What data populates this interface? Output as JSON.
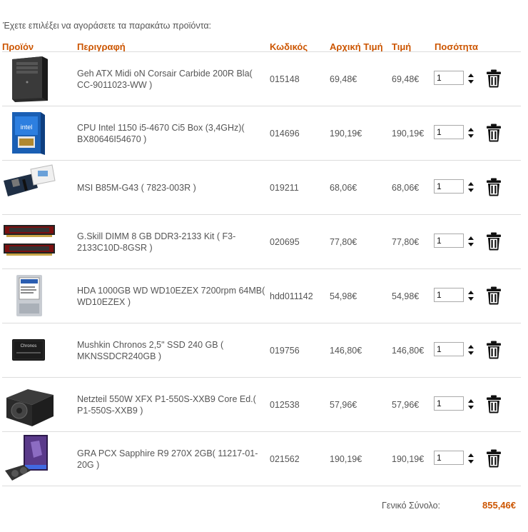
{
  "intro": "Έχετε επιλέξει να αγοράσετε τα παρακάτω προϊόντα:",
  "headers": {
    "product": "Προϊόν",
    "description": "Περιγραφή",
    "code": "Κωδικός",
    "original_price": "Αρχική Τιμή",
    "price": "Τιμή",
    "quantity": "Ποσότητα"
  },
  "items": [
    {
      "image_icon": "pc-case-icon",
      "description": "Geh ATX Midi oN Corsair Carbide 200R Bla( CC-9011023-WW )",
      "code": "015148",
      "original_price": "69,48€",
      "price": "69,48€",
      "quantity": "1"
    },
    {
      "image_icon": "cpu-box-icon",
      "description": "CPU Intel 1150 i5-4670 Ci5 Box (3,4GHz)( BX80646I54670 )",
      "code": "014696",
      "original_price": "190,19€",
      "price": "190,19€",
      "quantity": "1"
    },
    {
      "image_icon": "motherboard-icon",
      "description": "MSI B85M-G43 ( 7823-003R )",
      "code": "019211",
      "original_price": "68,06€",
      "price": "68,06€",
      "quantity": "1"
    },
    {
      "image_icon": "ram-module-icon",
      "description": "G.Skill DIMM 8 GB DDR3-2133 Kit ( F3-2133C10D-8GSR )",
      "code": "020695",
      "original_price": "77,80€",
      "price": "77,80€",
      "quantity": "1"
    },
    {
      "image_icon": "hard-drive-icon",
      "description": "HDA 1000GB WD WD10EZEX 7200rpm 64MB( WD10EZEX )",
      "code": "hdd011142",
      "original_price": "54,98€",
      "price": "54,98€",
      "quantity": "1"
    },
    {
      "image_icon": "ssd-icon",
      "description": "Mushkin Chronos 2,5\" SSD 240 GB ( MKNSSDCR240GB )",
      "code": "019756",
      "original_price": "146,80€",
      "price": "146,80€",
      "quantity": "1"
    },
    {
      "image_icon": "power-supply-icon",
      "description": "Netzteil 550W XFX P1-550S-XXB9 Core Ed.( P1-550S-XXB9 )",
      "code": "012538",
      "original_price": "57,96€",
      "price": "57,96€",
      "quantity": "1"
    },
    {
      "image_icon": "graphics-card-icon",
      "description": "GRA PCX Sapphire R9 270X 2GB( 11217-01-20G )",
      "code": "021562",
      "original_price": "190,19€",
      "price": "190,19€",
      "quantity": "1"
    }
  ],
  "total_label": "Γενικό Σύνολο:",
  "total_value": "855,46€",
  "colors": {
    "accent": "#cc5500",
    "text": "#555555",
    "divider": "#dcdcdc"
  }
}
